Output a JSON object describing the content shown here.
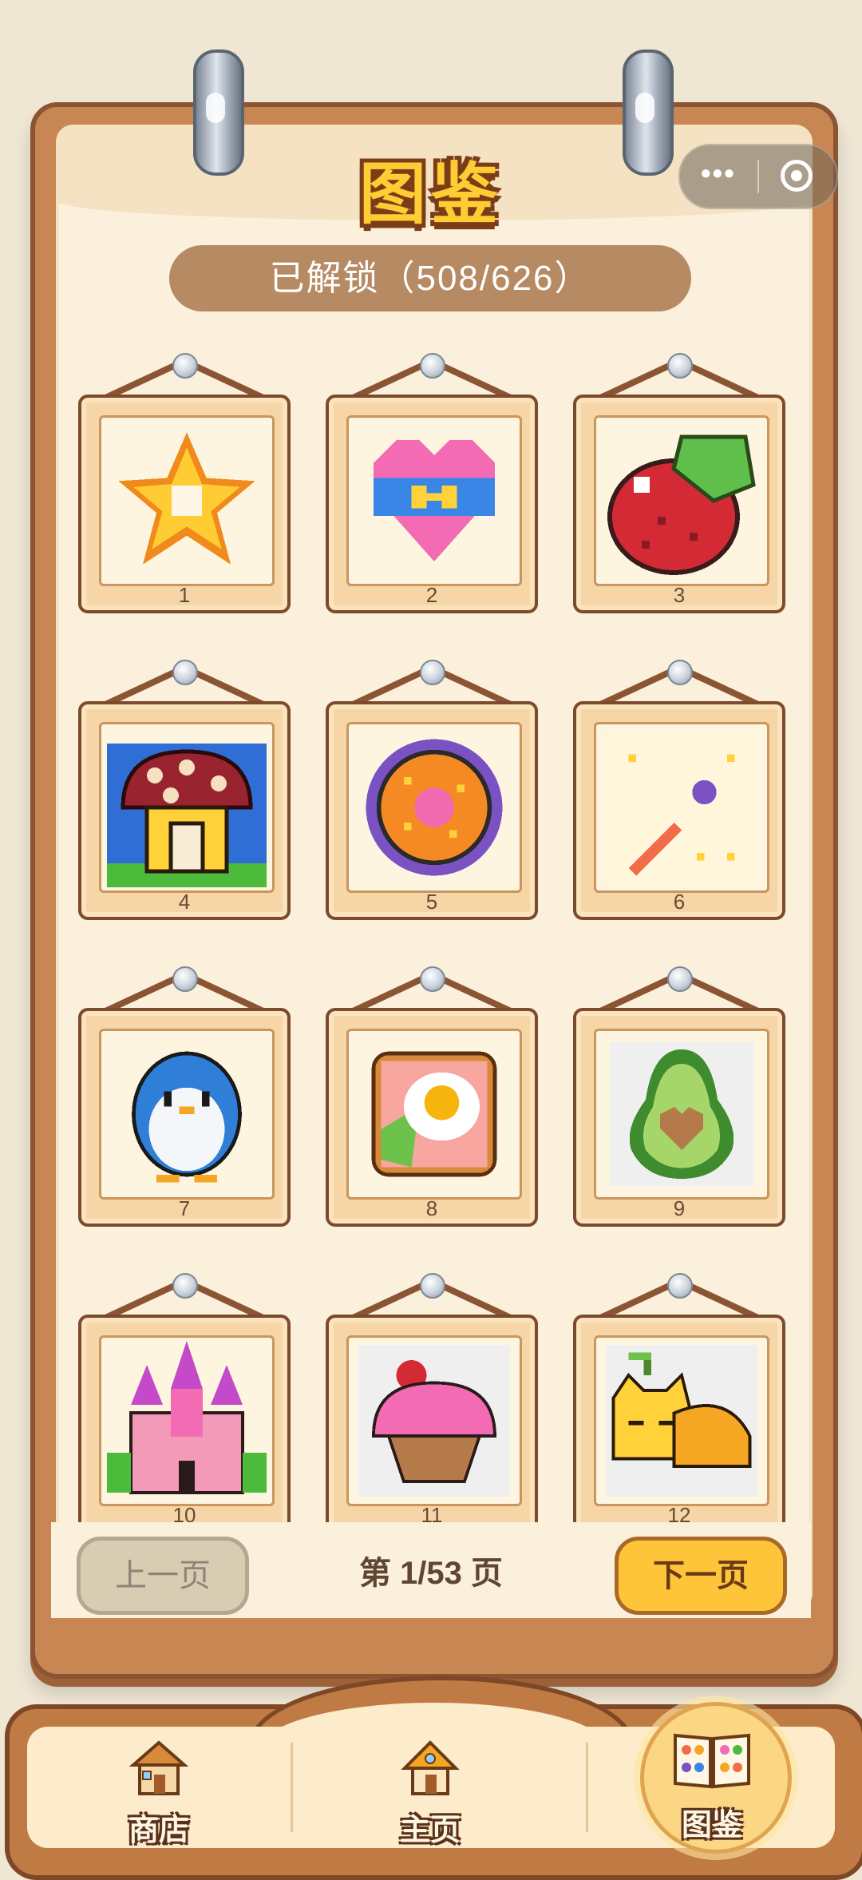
{
  "title": "图鉴",
  "unlocked_label": "已解锁（508/626）",
  "capsule": {
    "more_icon": "more-dots-icon",
    "close_icon": "target-circle-icon"
  },
  "tiles": [
    {
      "number": "1",
      "icon": "star-pixel-art"
    },
    {
      "number": "2",
      "icon": "heart-pixel-art"
    },
    {
      "number": "3",
      "icon": "strawberry-pixel-art"
    },
    {
      "number": "4",
      "icon": "mushroom-house-pixel-art"
    },
    {
      "number": "5",
      "icon": "pizza-pixel-art"
    },
    {
      "number": "6",
      "icon": "magic-wand-pixel-art"
    },
    {
      "number": "7",
      "icon": "penguin-pixel-art"
    },
    {
      "number": "8",
      "icon": "egg-toast-pixel-art"
    },
    {
      "number": "9",
      "icon": "avocado-pixel-art"
    },
    {
      "number": "10",
      "icon": "castle-pixel-art"
    },
    {
      "number": "11",
      "icon": "cupcake-pixel-art"
    },
    {
      "number": "12",
      "icon": "sleeping-cat-pixel-art"
    }
  ],
  "pagination": {
    "prev_label": "上一页",
    "page_indicator": "第 1/53 页",
    "next_label": "下一页"
  },
  "nav": [
    {
      "label": "商店",
      "icon": "shop-icon"
    },
    {
      "label": "主页",
      "icon": "home-icon"
    },
    {
      "label": "图鉴",
      "icon": "gallery-book-icon",
      "active": true
    }
  ],
  "colors": {
    "accent": "#ffc53a",
    "wood": "#c88752",
    "paper": "#faf0dc"
  }
}
